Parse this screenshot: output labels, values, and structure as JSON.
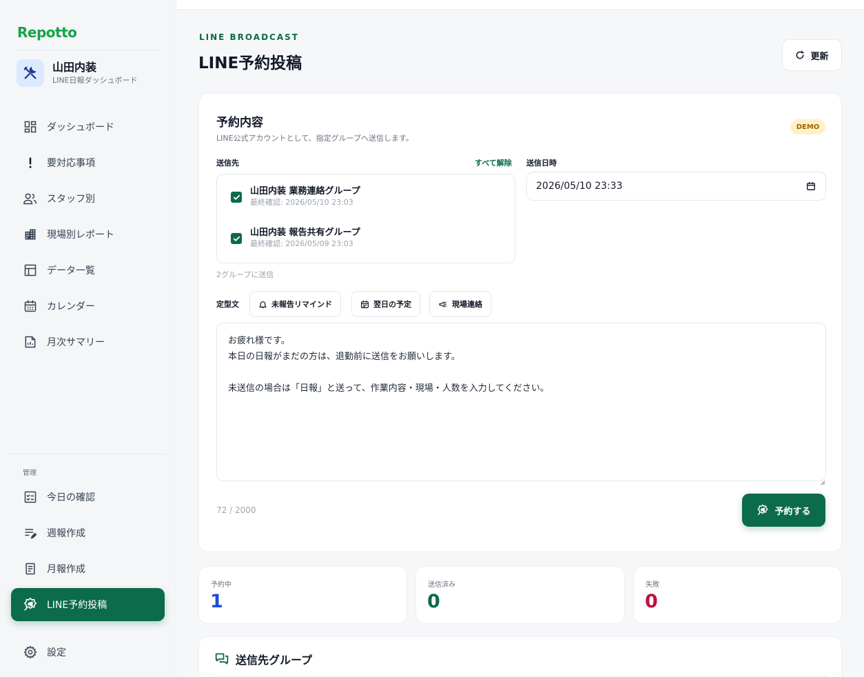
{
  "sidebar": {
    "logo": "Repotto",
    "brand_name": "山田内装",
    "brand_sub": "LINE日報ダッシュボード",
    "main_items": [
      {
        "label": "ダッシュボード",
        "icon": "dashboard-icon"
      },
      {
        "label": "要対応事項",
        "icon": "alert-icon"
      },
      {
        "label": "スタッフ別",
        "icon": "users-icon"
      },
      {
        "label": "現場別レポート",
        "icon": "building-icon"
      },
      {
        "label": "データ一覧",
        "icon": "table-icon"
      },
      {
        "label": "カレンダー",
        "icon": "calendar-icon"
      },
      {
        "label": "月次サマリー",
        "icon": "document-icon"
      }
    ],
    "section_label": "管理",
    "admin_items": [
      {
        "label": "今日の確認",
        "icon": "checklist-icon"
      },
      {
        "label": "週報作成",
        "icon": "edit-list-icon"
      },
      {
        "label": "月報作成",
        "icon": "report-icon"
      },
      {
        "label": "LINE予約投稿",
        "icon": "broadcast-icon",
        "active": true
      }
    ],
    "settings_label": "設定"
  },
  "header": {
    "eyebrow": "LINE BROADCAST",
    "title": "LINE予約投稿",
    "refresh_label": "更新"
  },
  "form": {
    "title": "予約内容",
    "description": "LINE公式アカウントとして、指定グループへ送信します。",
    "badge": "DEMO",
    "recipients_label": "送信先",
    "clear_all": "すべて解除",
    "groups": [
      {
        "name": "山田内装 業務連絡グループ",
        "meta": "最終確認: 2026/05/10 23:03",
        "checked": true
      },
      {
        "name": "山田内装 報告共有グループ",
        "meta": "最終確認: 2026/05/09 23:03",
        "checked": true
      }
    ],
    "send_count": "2グループに送信",
    "datetime_label": "送信日時",
    "datetime_value": "2026/05/10  23:33",
    "templates_label": "定型文",
    "templates": [
      {
        "label": "未報告リマインド",
        "icon": "bell-icon"
      },
      {
        "label": "翌日の予定",
        "icon": "calendar-small-icon"
      },
      {
        "label": "現場連絡",
        "icon": "megaphone-icon"
      }
    ],
    "message": "お疲れ様です。\n本日の日報がまだの方は、退勤前に送信をお願いします。\n\n未送信の場合は「日報」と送って、作業内容・現場・人数を入力してください。",
    "char_count": "72 / 2000",
    "submit_label": "予約する"
  },
  "stats": [
    {
      "label": "予約中",
      "value": "1",
      "color": "#1d4ed8"
    },
    {
      "label": "送信済み",
      "value": "0",
      "color": "#0b6b4a"
    },
    {
      "label": "失敗",
      "value": "0",
      "color": "#be123c"
    }
  ],
  "groups_section": {
    "title": "送信先グループ"
  },
  "colors": {
    "primary": "#0b6b4a",
    "logo": "#16a34a",
    "badge_bg": "#fdf1c7"
  }
}
